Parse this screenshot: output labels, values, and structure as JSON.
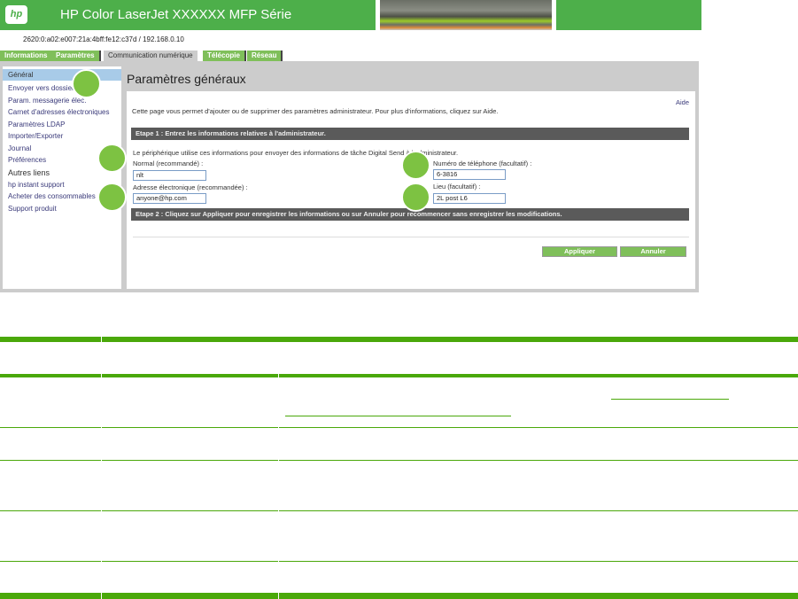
{
  "header": {
    "title": "HP Color LaserJet XXXXXX MFP Série",
    "logo_text": "hp",
    "device_address": "2620:0:a02:e007:21a:4bff:fe12:c37d / 192.168.0.10"
  },
  "tabs": [
    {
      "label": "Informations"
    },
    {
      "label": "Paramètres"
    },
    {
      "label": "Communication numérique",
      "active": true
    },
    {
      "label": "Télécopie"
    },
    {
      "label": "Réseau"
    }
  ],
  "sidebar": {
    "items": [
      "Général",
      "Envoyer vers dossier",
      "Param. messagerie élec.",
      "Carnet d'adresses électroniques",
      "Paramètres LDAP",
      "Importer/Exporter",
      "Journal",
      "Préférences"
    ],
    "other_heading": "Autres liens",
    "other_links": [
      "hp instant support",
      "Acheter des consommables",
      "Support produit"
    ]
  },
  "main": {
    "title": "Paramètres généraux",
    "help_link": "Aide",
    "description": "Cette page vous permet d'ajouter ou de supprimer des paramètres administrateur. Pour plus d'informations, cliquez sur Aide.",
    "step1": "Etape 1 : Entrez les informations relatives à l'administrateur.",
    "step1_note": "Le périphérique utilise ces informations pour envoyer des informations de tâche Digital Send à l'administrateur.",
    "fields": {
      "name_label": "Normal (recommandé) :",
      "name_value": "nlt",
      "email_label": "Adresse électronique (recommandée) :",
      "email_value": "anyone@hp.com",
      "phone_label": "Numéro de téléphone (facultatif) :",
      "phone_value": "6-3816",
      "location_label": "Lieu (facultatif) :",
      "location_value": "2L post L6"
    },
    "step2": "Etape 2 : Cliquez sur Appliquer pour enregistrer les informations ou sur Annuler pour recommencer sans enregistrer les modifications.",
    "apply_label": "Appliquer",
    "cancel_label": "Annuler"
  },
  "colors": {
    "brand_green": "#4daf4a",
    "table_rule": "#4aa80a",
    "callout": "#7dc242"
  }
}
